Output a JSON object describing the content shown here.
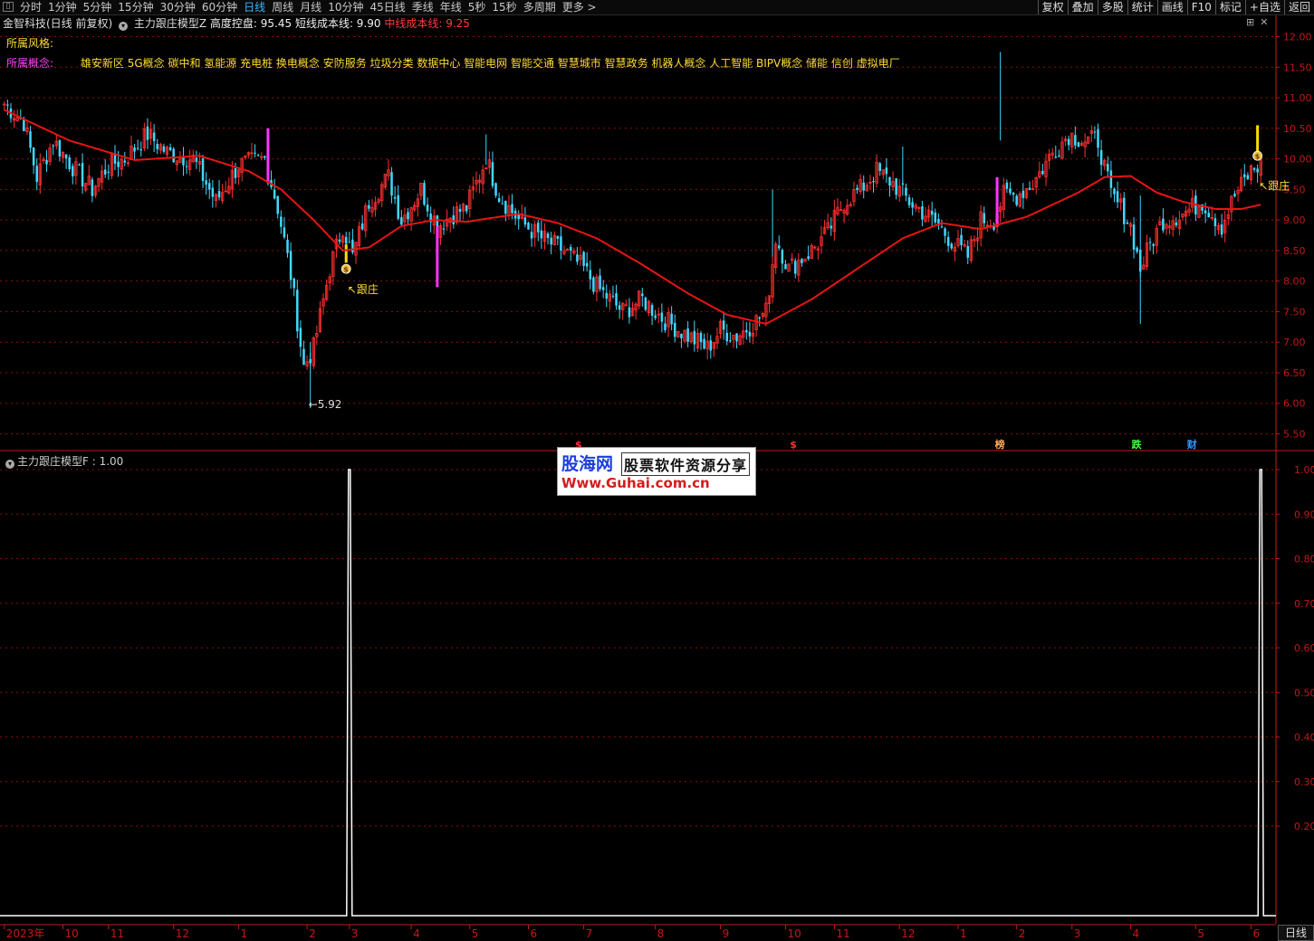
{
  "toolbar": {
    "tabs": [
      "分时",
      "1分钟",
      "5分钟",
      "15分钟",
      "30分钟",
      "60分钟",
      "日线",
      "周线",
      "月线",
      "10分钟",
      "45日线",
      "季线",
      "年线",
      "5秒",
      "15秒",
      "多周期",
      "更多 >"
    ],
    "active_tab": "日线",
    "right_buttons": [
      "复权",
      "叠加",
      "多股",
      "统计",
      "画线",
      "F10",
      "标记",
      "+自选",
      "返回"
    ]
  },
  "info": {
    "stock": "金智科技(日线 前复权)",
    "indicator": "主力跟庄模型Z",
    "high_label": "高度控盘: 95.45",
    "short_label": "短线成本线: 9.90",
    "mid_label": "中线成本线: 9.25"
  },
  "style_label": "所属风格:",
  "concept_label": "所属概念:",
  "concepts": "雄安新区 5G概念 碳中和 氢能源 充电桩 换电概念 安防服务 垃圾分类 数据中心 智能电网 智能交通 智慧城市 智慧政务 机器人概念 人工智能 BIPV概念 储能 信创 虚拟电厂",
  "indicator_title": "主力跟庄模型F : 1.00",
  "logo": {
    "line1": "股海网",
    "line1b": "股票软件资源分享",
    "line2": "Www.Guhai.com.cn"
  },
  "period_button": "日线",
  "colors": {
    "up": "#ff3030",
    "down": "#40d8ff",
    "ma": "#e81414",
    "grid": "#8a1010",
    "axis": "#c41818",
    "signal": "#ffffff"
  },
  "chart_data": [
    {
      "type": "candlestick",
      "ylim": [
        5.3,
        12.2
      ],
      "yticks": [
        12.0,
        11.5,
        11.0,
        10.5,
        10.0,
        9.5,
        9.0,
        8.5,
        8.0,
        7.5,
        7.0,
        6.5,
        6.0,
        5.5
      ],
      "x_labels": [
        "2023年",
        "10",
        "11",
        "12",
        "1",
        "2",
        "3",
        "4",
        "5",
        "6",
        "7",
        "8",
        "9",
        "10",
        "11",
        "12",
        "1",
        "2",
        "3",
        "4",
        "5",
        "6"
      ],
      "x_label_index": [
        0,
        18,
        32,
        52,
        72,
        93,
        106,
        125,
        143,
        161,
        178,
        200,
        220,
        240,
        255,
        275,
        293,
        311,
        328,
        346,
        366,
        383
      ],
      "n_bars": 387,
      "anchors": [
        [
          0,
          10.9
        ],
        [
          6,
          10.6
        ],
        [
          10,
          9.7
        ],
        [
          15,
          10.3
        ],
        [
          22,
          9.8
        ],
        [
          27,
          9.5
        ],
        [
          32,
          9.9
        ],
        [
          37,
          10.0
        ],
        [
          44,
          10.4
        ],
        [
          50,
          10.1
        ],
        [
          58,
          10.0
        ],
        [
          65,
          9.3
        ],
        [
          72,
          9.9
        ],
        [
          80,
          10.0
        ],
        [
          84,
          9.2
        ],
        [
          88,
          8.1
        ],
        [
          92,
          6.6
        ],
        [
          95,
          6.9
        ],
        [
          100,
          8.2
        ],
        [
          104,
          8.9
        ],
        [
          107,
          8.4
        ],
        [
          112,
          9.3
        ],
        [
          118,
          9.7
        ],
        [
          122,
          9.0
        ],
        [
          128,
          9.5
        ],
        [
          133,
          8.9
        ],
        [
          138,
          9.1
        ],
        [
          142,
          9.2
        ],
        [
          148,
          10.0
        ],
        [
          152,
          9.4
        ],
        [
          158,
          9.0
        ],
        [
          165,
          8.7
        ],
        [
          172,
          8.5
        ],
        [
          178,
          8.2
        ],
        [
          182,
          7.9
        ],
        [
          190,
          7.5
        ],
        [
          196,
          7.7
        ],
        [
          202,
          7.4
        ],
        [
          210,
          7.1
        ],
        [
          216,
          6.9
        ],
        [
          220,
          7.2
        ],
        [
          225,
          7.1
        ],
        [
          230,
          7.3
        ],
        [
          234,
          7.5
        ],
        [
          237,
          8.7
        ],
        [
          241,
          8.2
        ],
        [
          248,
          8.5
        ],
        [
          253,
          8.8
        ],
        [
          258,
          9.3
        ],
        [
          263,
          9.5
        ],
        [
          268,
          9.8
        ],
        [
          273,
          9.6
        ],
        [
          278,
          9.3
        ],
        [
          283,
          9.1
        ],
        [
          287,
          8.9
        ],
        [
          292,
          8.6
        ],
        [
          296,
          8.4
        ],
        [
          300,
          9.0
        ],
        [
          304,
          9.0
        ],
        [
          307,
          9.4
        ],
        [
          311,
          9.4
        ],
        [
          316,
          9.6
        ],
        [
          322,
          10.1
        ],
        [
          327,
          10.4
        ],
        [
          332,
          10.3
        ],
        [
          336,
          10.3
        ],
        [
          340,
          9.4
        ],
        [
          343,
          9.2
        ],
        [
          346,
          8.9
        ],
        [
          349,
          8.2
        ],
        [
          352,
          8.6
        ],
        [
          356,
          9.0
        ],
        [
          362,
          9.1
        ],
        [
          368,
          9.3
        ],
        [
          374,
          8.9
        ],
        [
          378,
          9.4
        ],
        [
          383,
          9.8
        ],
        [
          386,
          9.9
        ]
      ],
      "ma_anchors": [
        [
          0,
          10.8
        ],
        [
          20,
          10.3
        ],
        [
          40,
          9.98
        ],
        [
          60,
          10.05
        ],
        [
          75,
          9.8
        ],
        [
          85,
          9.5
        ],
        [
          95,
          9.0
        ],
        [
          104,
          8.5
        ],
        [
          112,
          8.55
        ],
        [
          122,
          8.9
        ],
        [
          132,
          9.0
        ],
        [
          142,
          8.97
        ],
        [
          158,
          9.1
        ],
        [
          170,
          8.95
        ],
        [
          182,
          8.7
        ],
        [
          195,
          8.3
        ],
        [
          210,
          7.8
        ],
        [
          222,
          7.45
        ],
        [
          234,
          7.3
        ],
        [
          248,
          7.7
        ],
        [
          262,
          8.2
        ],
        [
          276,
          8.7
        ],
        [
          288,
          8.95
        ],
        [
          300,
          8.85
        ],
        [
          314,
          9.05
        ],
        [
          330,
          9.45
        ],
        [
          338,
          9.7
        ],
        [
          346,
          9.72
        ],
        [
          354,
          9.45
        ],
        [
          362,
          9.3
        ],
        [
          372,
          9.18
        ],
        [
          380,
          9.18
        ],
        [
          386,
          9.25
        ]
      ],
      "annotations": [
        {
          "text": "←5.92",
          "bar": 94,
          "price": 5.92
        },
        {
          "text": "↖跟庄",
          "bar": 106,
          "price": 7.8
        },
        {
          "text": "↖跟庄",
          "bar": 386,
          "price": 9.5
        }
      ],
      "magenta_bars": [
        [
          81,
          10.5,
          9.6
        ],
        [
          133,
          8.9,
          7.9
        ],
        [
          305,
          9.7,
          8.9
        ]
      ],
      "yellow_bars": [
        [
          105,
          8.6,
          8.3
        ],
        [
          385,
          10.55,
          10.08
        ]
      ],
      "coin_markers": [
        [
          105,
          8.2
        ],
        [
          385,
          10.05
        ]
      ],
      "event_markers": [
        {
          "text": "$",
          "bar": 177,
          "color": "#ff3030"
        },
        {
          "text": "$",
          "bar": 243,
          "color": "#ff3030"
        },
        {
          "text": "榜",
          "bar": 306,
          "color": "#ffaa55"
        },
        {
          "text": "跌",
          "bar": 348,
          "color": "#44ff44"
        },
        {
          "text": "财",
          "bar": 365,
          "color": "#3399ff"
        }
      ]
    },
    {
      "type": "line",
      "ylim": [
        0,
        1.0
      ],
      "yticks": [
        "1.00",
        "0.90",
        "0.80",
        "0.70",
        "0.60",
        "0.50",
        "0.40",
        "0.30",
        "0.20"
      ],
      "values_desc": "0 everywhere except spikes to 1 at bars 106 and 386",
      "spikes": [
        106,
        386
      ]
    }
  ]
}
